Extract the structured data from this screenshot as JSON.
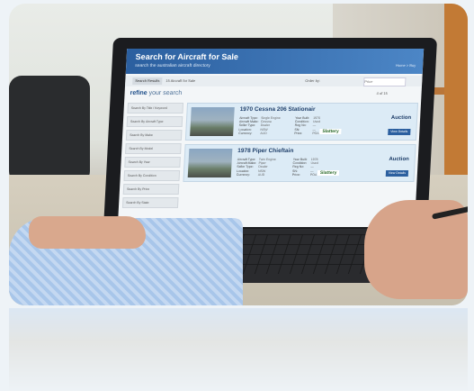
{
  "site": {
    "title": "Search for Aircraft for Sale",
    "subtitle": "search the australian aircraft directory",
    "nav": "Home > Buy"
  },
  "toolbar": {
    "search_button": "Search Results",
    "results_count": "15 Aircraft for Sale",
    "sort_label": "Order by:",
    "sort_value": "Price"
  },
  "sidebar": {
    "heading_a": "refine",
    "heading_b": " your search",
    "items": [
      {
        "label": "Search By Title / Keyword"
      },
      {
        "label": "Search By Aircraft Type"
      },
      {
        "label": "Search By Make"
      },
      {
        "label": "Search By Model"
      },
      {
        "label": "Search By Year"
      },
      {
        "label": "Search By Condition"
      },
      {
        "label": "Search By Price"
      },
      {
        "label": "Search By State"
      }
    ]
  },
  "pager": {
    "text": "4 of 15"
  },
  "listings": [
    {
      "title": "1970 Cessna 206 Stationair",
      "labels": "Aircraft Type:\nAircraft Make:\nSeller Type:\nLocation:\nCurrency:",
      "values": "Single Engine\nCessna\nDealer\nNSW\nAUD",
      "labels2": "Year Built:\nCondition:\nReg No:\nSN:\nPrice:",
      "values2": "1970\nUsed\n—\n—\nPOA",
      "sale_type": "Auction",
      "brand": "Slattery",
      "button": "View Details"
    },
    {
      "title": "1978 Piper Chieftain",
      "labels": "Aircraft Type:\nAircraft Make:\nSeller Type:\nLocation:\nCurrency:",
      "values": "Twin Engine\nPiper\nDealer\nNSW\nAUD",
      "labels2": "Year Built:\nCondition:\nReg No:\nSN:\nPrice:",
      "values2": "1978\nUsed\n—\n—\nPOA",
      "sale_type": "Auction",
      "brand": "Slattery",
      "button": "View Details"
    }
  ],
  "colors": {
    "header": "#2b5f9f",
    "accent": "#1f3f6a",
    "card": "#dcebf6"
  }
}
